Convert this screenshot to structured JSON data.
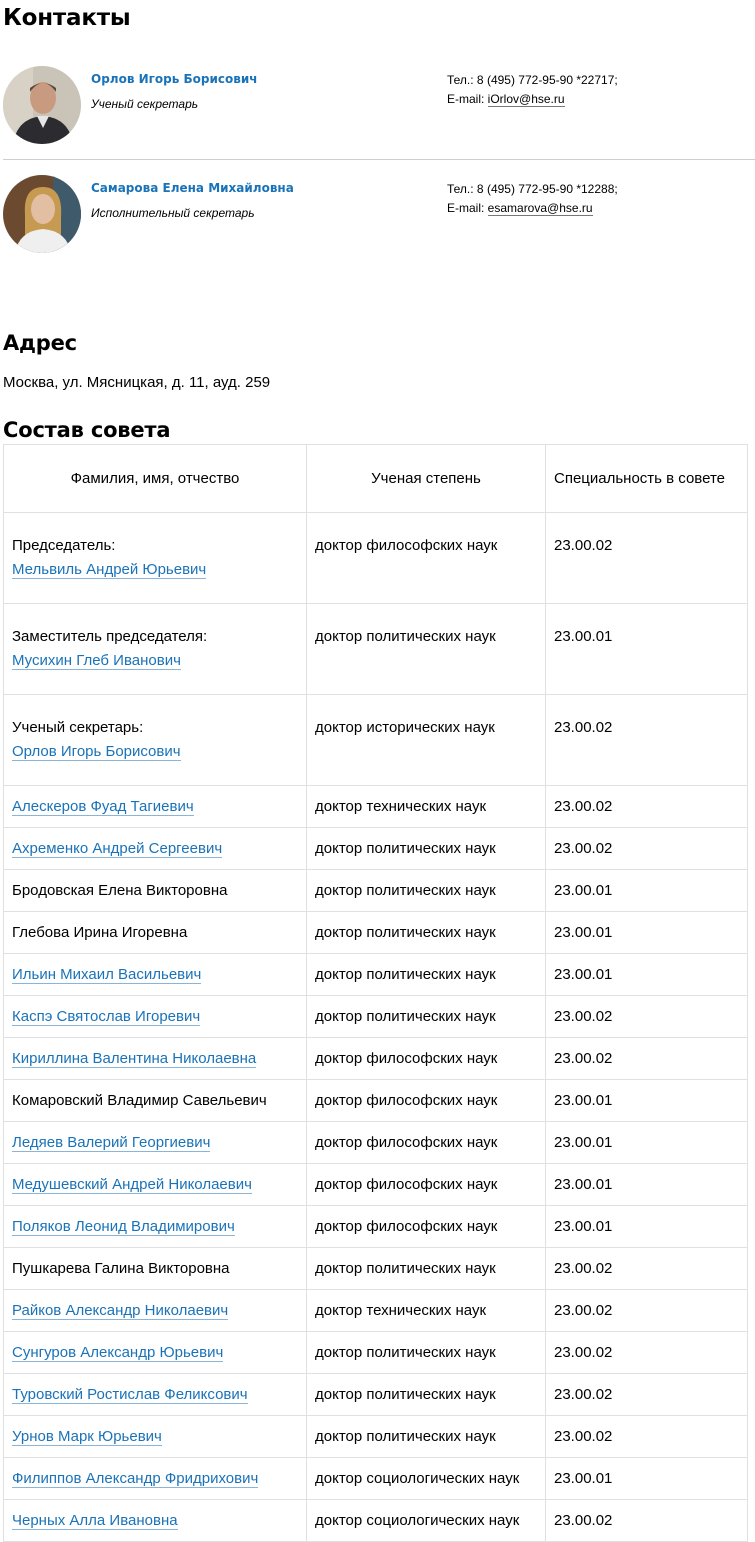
{
  "contacts": {
    "title": "Контакты",
    "people": [
      {
        "name": "Орлов Игорь Борисович",
        "role": "Ученый секретарь",
        "phone": "Тел.: 8 (495) 772-95-90 *22717;",
        "email_label": "E-mail: ",
        "email": "iOrlov@hse.ru"
      },
      {
        "name": "Самарова Елена Михайловна",
        "role": "Исполнительный секретарь",
        "phone": "Тел.: 8 (495) 772-95-90 *12288;",
        "email_label": "E-mail: ",
        "email": "esamarova@hse.ru"
      }
    ]
  },
  "address": {
    "title": "Адрес",
    "text": "Москва, ул. Мясницкая, д. 11, ауд. 259"
  },
  "council": {
    "title": "Состав совета",
    "headers": [
      "Фамилия, имя, отчество",
      "Ученая степень",
      "Специальность в совете"
    ],
    "rows": [
      {
        "position": "Председатель:",
        "name": "Мельвиль Андрей Юрьевич",
        "link": true,
        "degree": "доктор философских наук",
        "spec": "23.00.02"
      },
      {
        "position": "Заместитель председателя:",
        "name": "Мусихин Глеб Иванович",
        "link": true,
        "degree": "доктор политических наук",
        "spec": "23.00.01"
      },
      {
        "position": "Ученый секретарь:",
        "name": "Орлов Игорь Борисович",
        "link": true,
        "degree": "доктор исторических наук",
        "spec": "23.00.02"
      },
      {
        "position": "",
        "name": "Алескеров Фуад Тагиевич",
        "link": true,
        "degree": "доктор технических наук",
        "spec": "23.00.02"
      },
      {
        "position": "",
        "name": "Ахременко Андрей Сергеевич",
        "link": true,
        "degree": "доктор политических наук",
        "spec": "23.00.02"
      },
      {
        "position": "",
        "name": "Бродовская Елена Викторовна",
        "link": false,
        "degree": "доктор политических наук",
        "spec": "23.00.01"
      },
      {
        "position": "",
        "name": "Глебова Ирина Игоревна",
        "link": false,
        "degree": "доктор политических наук",
        "spec": "23.00.01"
      },
      {
        "position": "",
        "name": "Ильин Михаил Васильевич",
        "link": true,
        "degree": "доктор политических наук",
        "spec": "23.00.01"
      },
      {
        "position": "",
        "name": "Каспэ Святослав Игоревич",
        "link": true,
        "degree": "доктор политических наук",
        "spec": "23.00.02"
      },
      {
        "position": "",
        "name": "Кириллина Валентина Николаевна",
        "link": true,
        "degree": "доктор философских наук",
        "spec": "23.00.02"
      },
      {
        "position": "",
        "name": "Комаровский Владимир Савельевич",
        "link": false,
        "degree": "доктор философских наук",
        "spec": "23.00.01"
      },
      {
        "position": "",
        "name": "Ледяев Валерий Георгиевич",
        "link": true,
        "degree": "доктор философских наук",
        "spec": "23.00.01"
      },
      {
        "position": "",
        "name": "Медушевский Андрей Николаевич",
        "link": true,
        "degree": "доктор философских наук",
        "spec": "23.00.01"
      },
      {
        "position": "",
        "name": "Поляков Леонид Владимирович",
        "link": true,
        "degree": "доктор философских наук",
        "spec": "23.00.01"
      },
      {
        "position": "",
        "name": "Пушкарева Галина Викторовна",
        "link": false,
        "degree": "доктор политических наук",
        "spec": "23.00.02"
      },
      {
        "position": "",
        "name": "Райков Александр Николаевич",
        "link": true,
        "degree": "доктор технических наук",
        "spec": "23.00.02"
      },
      {
        "position": "",
        "name": "Сунгуров Александр Юрьевич",
        "link": true,
        "degree": "доктор политических наук",
        "spec": "23.00.02"
      },
      {
        "position": "",
        "name": "Туровский Ростислав Феликсович",
        "link": true,
        "degree": "доктор политических наук",
        "spec": "23.00.02"
      },
      {
        "position": "",
        "name": "Урнов Марк Юрьевич",
        "link": true,
        "degree": "доктор политических наук",
        "spec": "23.00.02"
      },
      {
        "position": "",
        "name": "Филиппов Александр Фридрихович",
        "link": true,
        "degree": "доктор социологических наук",
        "spec": "23.00.01"
      },
      {
        "position": "",
        "name": "Черных Алла Ивановна",
        "link": true,
        "degree": "доктор социологических наук",
        "spec": "23.00.02"
      }
    ]
  },
  "colors": {
    "link": "#1a73b8",
    "border": "#e0e0e0"
  }
}
